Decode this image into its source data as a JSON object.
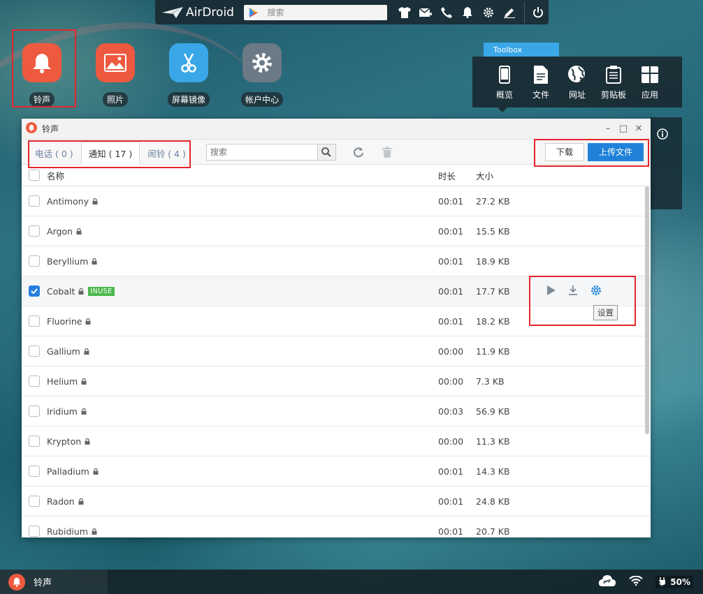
{
  "topbar": {
    "brand": "AirDroid",
    "search_placeholder": "搜索"
  },
  "desktop": {
    "icons": [
      {
        "label": "铃声",
        "color": "#ee5a3f",
        "icon": "bell-icon"
      },
      {
        "label": "照片",
        "color": "#ee5a3f",
        "icon": "image-icon"
      },
      {
        "label": "屏幕镜像",
        "color": "#3aa7e8",
        "icon": "scissors-icon"
      },
      {
        "label": "帐户中心",
        "color": "#6b7a86",
        "icon": "gear-icon"
      }
    ]
  },
  "toolbox": {
    "tab_label": "Toolbox",
    "items": [
      {
        "label": "概览",
        "icon": "phone-icon"
      },
      {
        "label": "文件",
        "icon": "file-icon"
      },
      {
        "label": "网址",
        "icon": "globe-icon"
      },
      {
        "label": "剪贴板",
        "icon": "clipboard-icon"
      },
      {
        "label": "应用",
        "icon": "apps-icon"
      }
    ]
  },
  "window": {
    "title": "铃声",
    "tabs": [
      {
        "label": "电话 ( 0 )"
      },
      {
        "label": "通知 ( 17 )"
      },
      {
        "label": "闹铃 ( 4 )"
      }
    ],
    "search_placeholder": "搜索",
    "download_label": "下载",
    "upload_label": "上传文件",
    "columns": {
      "name": "名称",
      "duration": "时长",
      "size": "大小"
    },
    "tooltip": "设置",
    "inuse_badge": "INUSE",
    "rows": [
      {
        "name": "Antimony",
        "duration": "00:01",
        "size": "27.2 KB",
        "checked": false
      },
      {
        "name": "Argon",
        "duration": "00:01",
        "size": "15.5 KB",
        "checked": false
      },
      {
        "name": "Beryllium",
        "duration": "00:01",
        "size": "18.9 KB",
        "checked": false
      },
      {
        "name": "Cobalt",
        "duration": "00:01",
        "size": "17.7 KB",
        "checked": true
      },
      {
        "name": "Fluorine",
        "duration": "00:01",
        "size": "18.2 KB",
        "checked": false
      },
      {
        "name": "Gallium",
        "duration": "00:00",
        "size": "11.9 KB",
        "checked": false
      },
      {
        "name": "Helium",
        "duration": "00:00",
        "size": "7.3 KB",
        "checked": false
      },
      {
        "name": "Iridium",
        "duration": "00:03",
        "size": "56.9 KB",
        "checked": false
      },
      {
        "name": "Krypton",
        "duration": "00:00",
        "size": "11.3 KB",
        "checked": false
      },
      {
        "name": "Palladium",
        "duration": "00:01",
        "size": "14.3 KB",
        "checked": false
      },
      {
        "name": "Radon",
        "duration": "00:01",
        "size": "24.8 KB",
        "checked": false
      },
      {
        "name": "Rubidium",
        "duration": "00:01",
        "size": "20.7 KB",
        "checked": false
      }
    ]
  },
  "taskbar": {
    "app_label": "铃声",
    "battery": "50%"
  }
}
